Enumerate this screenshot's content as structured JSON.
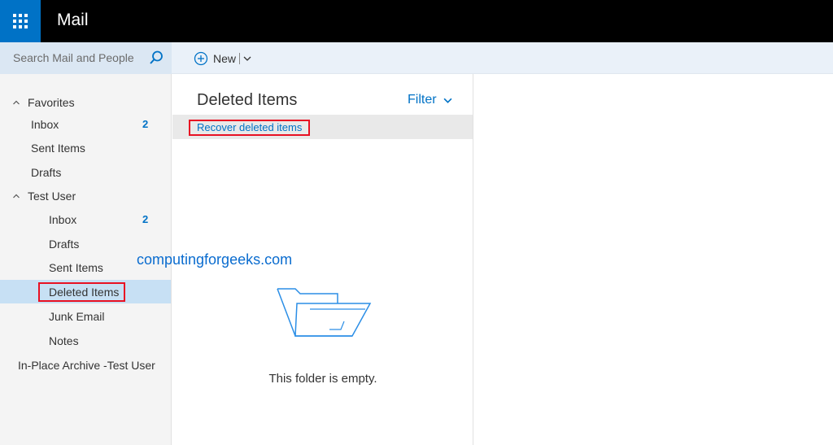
{
  "header": {
    "app_title": "Mail"
  },
  "search": {
    "placeholder": "Search Mail and People"
  },
  "toolbar": {
    "new_label": "New"
  },
  "nav": {
    "favorites_label": "Favorites",
    "favorites": [
      {
        "label": "Inbox",
        "count": "2"
      },
      {
        "label": "Sent Items"
      },
      {
        "label": "Drafts"
      }
    ],
    "account_label": "Test User",
    "account_items": [
      {
        "label": "Inbox",
        "count": "2"
      },
      {
        "label": "Drafts"
      },
      {
        "label": "Sent Items"
      },
      {
        "label": "Deleted Items",
        "selected": true
      },
      {
        "label": "Junk Email"
      },
      {
        "label": "Notes"
      }
    ],
    "archive_label": "In-Place Archive -Test User"
  },
  "list": {
    "title": "Deleted Items",
    "filter_label": "Filter",
    "recover_label": "Recover deleted items",
    "empty_message": "This folder is empty."
  },
  "watermark": "computingforgeeks.com",
  "colors": {
    "accent": "#0072c6",
    "selected_bg": "#c7e0f4",
    "highlight_border": "#e81123"
  }
}
